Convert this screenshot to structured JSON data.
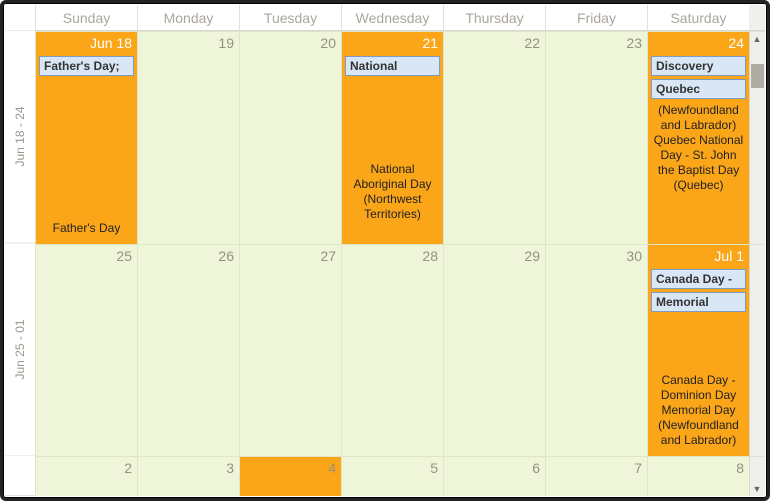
{
  "weekdays": [
    "Sunday",
    "Monday",
    "Tuesday",
    "Wednesday",
    "Thursday",
    "Friday",
    "Saturday"
  ],
  "rows": [
    {
      "label": "Jun 18 - 24",
      "cells": [
        {
          "date": "Jun 18",
          "hot": true,
          "chips": [
            "Father's Day;"
          ],
          "desc": "Father's Day",
          "descPos": "bottom"
        },
        {
          "date": "19"
        },
        {
          "date": "20"
        },
        {
          "date": "21",
          "hot": true,
          "chips": [
            "National"
          ],
          "desc": "National Aboriginal Day (Northwest Territories)",
          "descPos": "mid"
        },
        {
          "date": "22"
        },
        {
          "date": "23"
        },
        {
          "date": "24",
          "hot": true,
          "chips": [
            "Discovery",
            "Quebec"
          ],
          "desc": "(Newfoundland and Labrador) Quebec National Day - St. John the Baptist Day (Quebec)"
        }
      ]
    },
    {
      "label": "Jun 25 - 01",
      "cells": [
        {
          "date": "25"
        },
        {
          "date": "26"
        },
        {
          "date": "27"
        },
        {
          "date": "28"
        },
        {
          "date": "29"
        },
        {
          "date": "30"
        },
        {
          "date": "Jul 1",
          "hot": true,
          "chips": [
            "Canada Day -",
            "Memorial"
          ],
          "desc": "Canada Day - Dominion Day Memorial Day (Newfoundland and Labrador)",
          "descPos": "mid"
        }
      ]
    },
    {
      "label": "",
      "cells": [
        {
          "date": "2"
        },
        {
          "date": "3"
        },
        {
          "date": "4",
          "hot": true
        },
        {
          "date": "5"
        },
        {
          "date": "6"
        },
        {
          "date": "7"
        },
        {
          "date": "8"
        }
      ]
    }
  ]
}
